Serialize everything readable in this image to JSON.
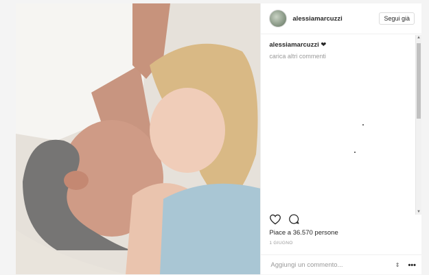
{
  "post": {
    "username": "alessiamarcuzzi",
    "follow_label": "Segui già",
    "caption_user": "alessiamarcuzzi",
    "caption_text": "❤",
    "load_more": "carica altri commenti",
    "likes": "Piace a 36.570 persone",
    "date": "1 GIUGNO",
    "comment_placeholder": "Aggiungi un commento...",
    "more_icon_glyph": "•••",
    "stepper_glyph": "⇕"
  },
  "icons": [
    "heart-icon",
    "comment-icon",
    "more-options-icon"
  ],
  "colors": {
    "text": "#262626",
    "muted": "#999999",
    "border": "#efefef",
    "background": "#f4f4f4"
  }
}
